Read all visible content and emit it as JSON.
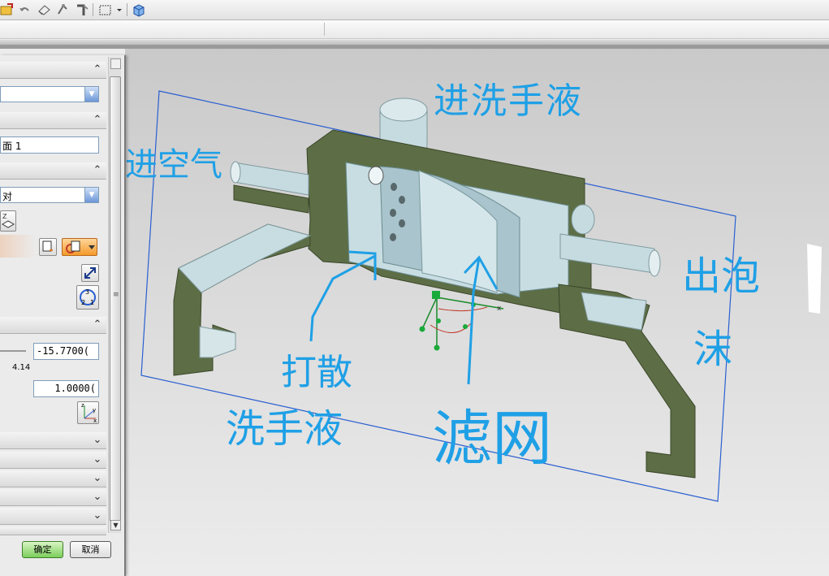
{
  "dialog": {
    "field_text_face": "面 1",
    "combo_align_value": "对",
    "offset_value": "-15.7700(",
    "slider_readout": "4.14",
    "scale_value": "1.0000(",
    "ok_label": "确定",
    "cancel_label": "取消"
  },
  "annotations": {
    "inlet_wash": "进洗手液",
    "inlet_air": "进空气",
    "outlet_foam_1": "出泡",
    "outlet_foam_2": "沫",
    "disperse_1": "打散",
    "disperse_2": "洗手液",
    "filter_mesh": "滤网"
  },
  "colors": {
    "annotation": "#1fa0e6",
    "section_fill": "#5d6e46",
    "solid": "#c8dde2",
    "frame": "#2a5fd0",
    "ok_button": "#7ccf5c"
  },
  "icons": {
    "toolbar": [
      "folder-icon",
      "undo-icon",
      "eraser-icon",
      "snap-icon",
      "measure-icon",
      "select-box-icon",
      "dropdown-icon",
      "cube-icon"
    ],
    "dialog": [
      "csys-icon",
      "plane-icon",
      "section-orient-icon",
      "flip-icon",
      "cycle-icon",
      "xyz-axes-icon"
    ]
  }
}
